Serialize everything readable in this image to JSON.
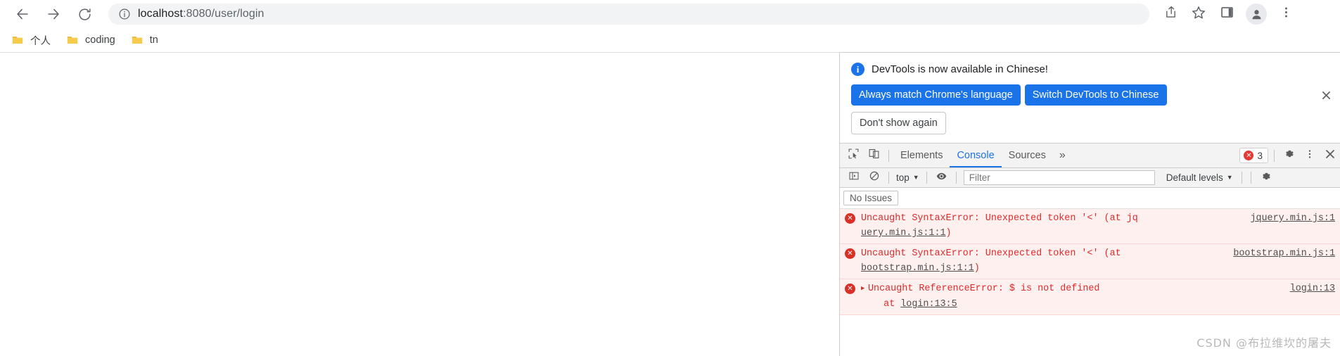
{
  "browser": {
    "nav": {
      "back_label": "Back",
      "forward_label": "Forward",
      "reload_label": "Reload"
    },
    "omnibox": {
      "info_icon": "info-circle-icon",
      "url_host": "localhost",
      "url_path": ":8080/user/login",
      "full_url": "localhost:8080/user/login"
    },
    "toolbar_icons": [
      {
        "name": "share-icon",
        "label": "Share"
      },
      {
        "name": "bookmark-star-icon",
        "label": "Bookmark this tab"
      },
      {
        "name": "side-panel-icon",
        "label": "Side panel"
      },
      {
        "name": "profile-avatar-icon",
        "label": "Profile"
      },
      {
        "name": "kebab-menu-icon",
        "label": "Customize and control Google Chrome"
      }
    ],
    "bookmarks": [
      {
        "label": "个人",
        "icon": "folder-icon"
      },
      {
        "label": "coding",
        "icon": "folder-icon"
      },
      {
        "label": "tn",
        "icon": "folder-icon"
      }
    ]
  },
  "devtools": {
    "notification": {
      "icon": "info-badge-icon",
      "message": "DevTools is now available in Chinese!",
      "primary_buttons": [
        "Always match Chrome's language",
        "Switch DevTools to Chinese"
      ],
      "secondary_button": "Don't show again",
      "close_icon": "close-icon"
    },
    "tabbar": {
      "inspect_icon": "inspect-element-icon",
      "device_icon": "device-toolbar-icon",
      "tabs": [
        {
          "label": "Elements",
          "active": false
        },
        {
          "label": "Console",
          "active": true
        },
        {
          "label": "Sources",
          "active": false
        }
      ],
      "more_tabs_icon": "chevron-double-right-icon",
      "error_count": "3",
      "error_badge_glyph": "✕",
      "settings_icon": "gear-icon",
      "kebab_icon": "kebab-menu-icon",
      "close_icon": "close-icon"
    },
    "console_toolbar": {
      "sidebar_icon": "console-sidebar-icon",
      "clear_icon": "clear-console-icon",
      "context": "top",
      "context_caret": "▼",
      "eye_icon": "live-expression-eye-icon",
      "filter_placeholder": "Filter",
      "filter_value": "",
      "levels": "Default levels",
      "levels_caret": "▼",
      "settings_icon": "gear-icon"
    },
    "issues": {
      "button_label": "No Issues"
    },
    "messages": [
      {
        "icon": "error-icon",
        "prefix": "Uncaught SyntaxError: Unexpected token '<' (at jq",
        "wrapped": "uery.min.js:1:1)",
        "wrapped_link": "uery.min.js:1:1",
        "wrapped_tail": ")",
        "right_link": "jquery.min.js:1",
        "has_disclosure": false
      },
      {
        "icon": "error-icon",
        "prefix": "Uncaught SyntaxError: Unexpected token '<' (at",
        "wrapped": "bootstrap.min.js:1:1)",
        "wrapped_link": "bootstrap.min.js:1:1",
        "wrapped_tail": ")",
        "right_link": "bootstrap.min.js:1",
        "has_disclosure": false
      },
      {
        "icon": "error-icon",
        "disclosure_glyph": "▶",
        "prefix": "Uncaught ReferenceError: $ is not defined",
        "wrapped_prefix": "    at ",
        "wrapped_link": "login:13:5",
        "wrapped_tail": "",
        "right_link": "login:13",
        "has_disclosure": true
      }
    ]
  },
  "watermark": "CSDN @布拉维坎的屠夫",
  "colors": {
    "accent": "#1a73e8",
    "error": "#d93025",
    "error_bg": "#fff0f0",
    "omnibox_bg": "#f1f3f4",
    "devtools_bg": "#f3f3f3"
  }
}
